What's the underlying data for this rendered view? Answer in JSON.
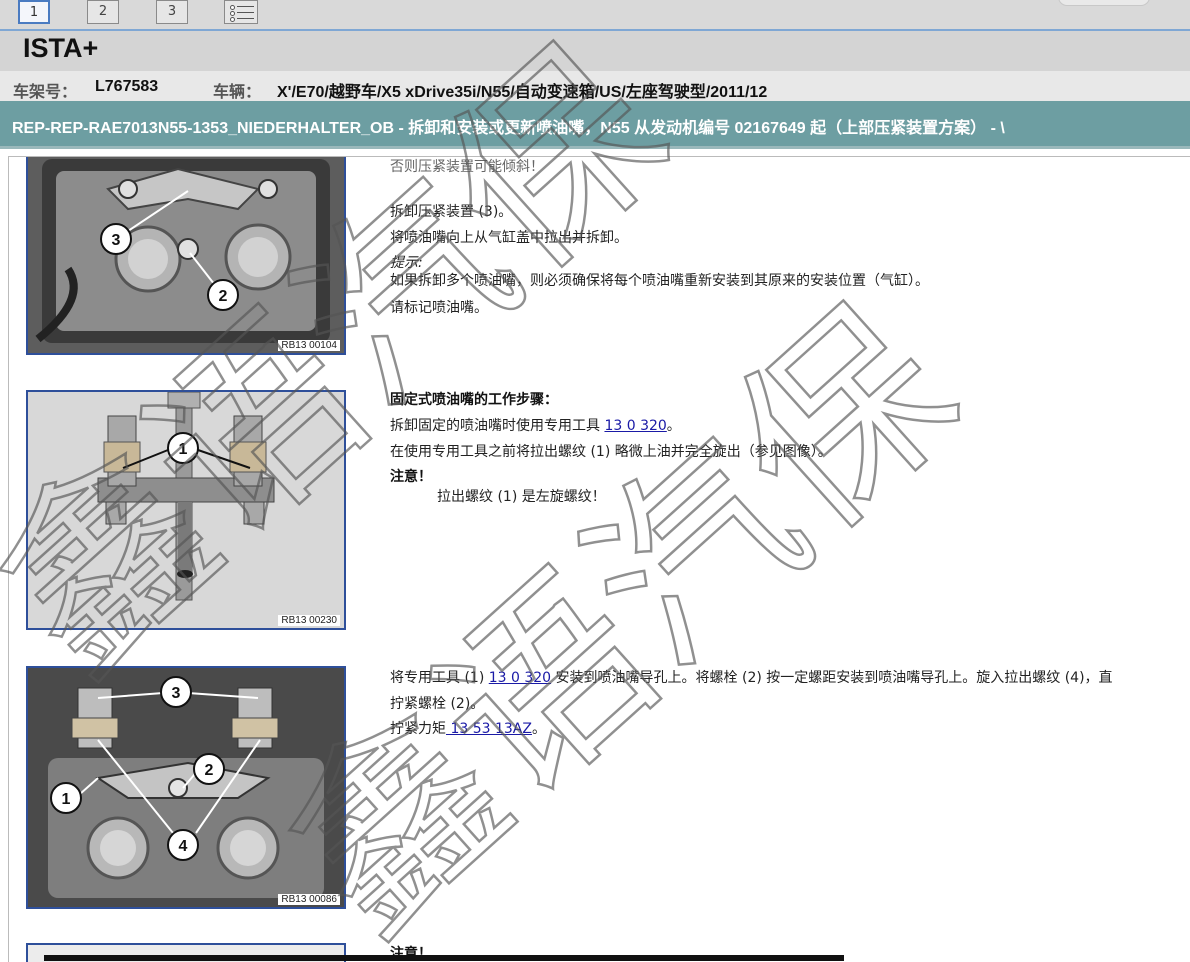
{
  "toolbar": {
    "tabs": [
      "1",
      "2",
      "3"
    ],
    "active_tab": "1",
    "list_button": "list-icon"
  },
  "brand": "ISTA+",
  "vehicle": {
    "vin_label": "车架号：",
    "vin": "L767583",
    "vehicle_label": "车辆：",
    "vehicle_desc": "X'/E70/越野车/X5 xDrive35i/N55/自动变速箱/US/左座驾驶型/2011/12"
  },
  "document": {
    "title": "REP-REP-RAE7013N55-1353_NIEDERHALTER_OB - 拆卸和安装或更新喷油嘴，N55 从发动机编号 02167649 起（上部压紧装置方案） - \\"
  },
  "sections": {
    "s1": {
      "fig_code": "RB13 00104",
      "cutoff": "否则压紧装置可能倾斜！",
      "line1": "拆卸压紧装置 (3)。",
      "line2": "将喷油嘴向上从气缸盖中拉出并拆卸。",
      "hint_label": "提示:",
      "hint_text": "如果拆卸多个喷油嘴，则必须确保将每个喷油嘴重新安装到其原来的安装位置（气缸）。",
      "line3": "请标记喷油嘴。"
    },
    "s2": {
      "fig_code": "RB13 00230",
      "heading": "固定式喷油嘴的工作步骤：",
      "line1_pre": "拆卸固定的喷油嘴时使用专用工具 ",
      "line1_link": "13 0 320",
      "line1_post": "。",
      "line2": "在使用专用工具之前将拉出螺纹 (1) 略微上油并完全旋出（参见图像）。",
      "note_label": "注意！",
      "note_text": "拉出螺纹 (1) 是左旋螺纹！"
    },
    "s3": {
      "fig_code": "RB13 00086",
      "line1_pre": "将专用工具 (1) ",
      "line1_link": "13 0 320",
      "line1_post": " 安装到喷油嘴导孔上。将螺栓 (2) 按一定螺距安装到喷油嘴导孔上。旋入拉出螺纹 (4)，直",
      "line2": "拧紧螺栓 (2)。",
      "line3_pre": "拧紧力矩",
      "line3_link": " 13 53 13AZ",
      "line3_post": "。"
    },
    "s4": {
      "note_label": "注意！"
    }
  },
  "callouts": {
    "fig1": [
      "3",
      "2"
    ],
    "fig2": [
      "1"
    ],
    "fig3": [
      "3",
      "2",
      "1",
      "4"
    ]
  },
  "watermark": {
    "text1": "鑫语汽保",
    "text2": "鑫语汽保"
  },
  "colors": {
    "title_bar": "#6d9ea2",
    "figure_border": "#2e4f9a",
    "link": "#1a1aa6"
  }
}
